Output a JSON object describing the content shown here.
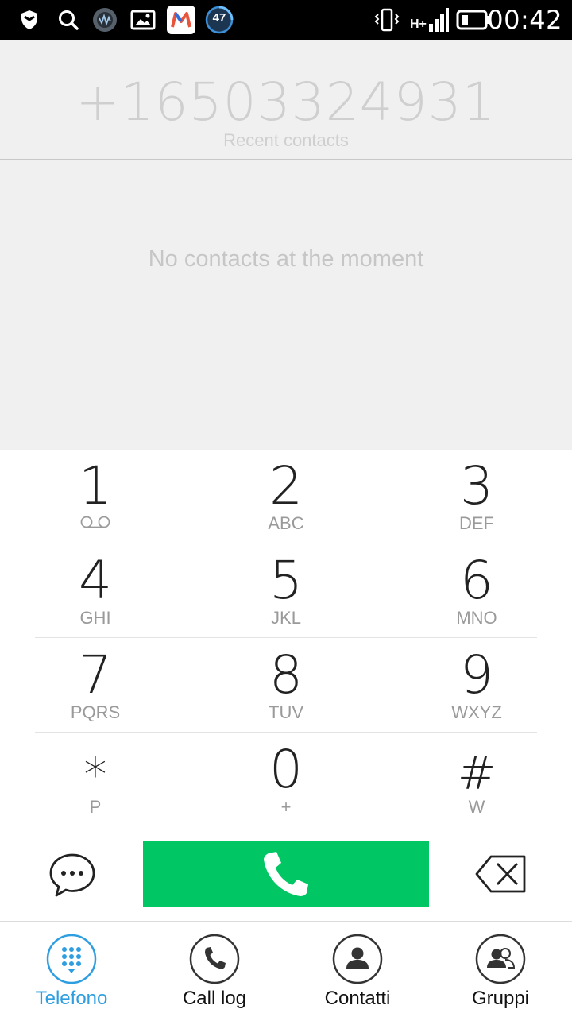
{
  "status_bar": {
    "time": "00:42",
    "badge_count": "47",
    "network_type": "H+"
  },
  "dialer": {
    "dialed_number": "+16503324931",
    "recent_label": "Recent contacts",
    "empty_message": "No contacts at the moment"
  },
  "keypad": {
    "keys": [
      {
        "digit": "1",
        "letters": ""
      },
      {
        "digit": "2",
        "letters": "ABC"
      },
      {
        "digit": "3",
        "letters": "DEF"
      },
      {
        "digit": "4",
        "letters": "GHI"
      },
      {
        "digit": "5",
        "letters": "JKL"
      },
      {
        "digit": "6",
        "letters": "MNO"
      },
      {
        "digit": "7",
        "letters": "PQRS"
      },
      {
        "digit": "8",
        "letters": "TUV"
      },
      {
        "digit": "9",
        "letters": "WXYZ"
      },
      {
        "digit": "*",
        "letters": "P"
      },
      {
        "digit": "0",
        "letters": "+"
      },
      {
        "digit": "#",
        "letters": "W"
      }
    ]
  },
  "actions": {
    "call_color": "#00c764"
  },
  "tabs": [
    {
      "label": "Telefono",
      "icon": "dialpad-icon",
      "active": true
    },
    {
      "label": "Call log",
      "icon": "phone-icon",
      "active": false
    },
    {
      "label": "Contatti",
      "icon": "person-icon",
      "active": false
    },
    {
      "label": "Gruppi",
      "icon": "group-icon",
      "active": false
    }
  ],
  "colors": {
    "accent": "#2f9ee0",
    "call_green": "#00c764",
    "background_gray": "#f0f0f0"
  }
}
